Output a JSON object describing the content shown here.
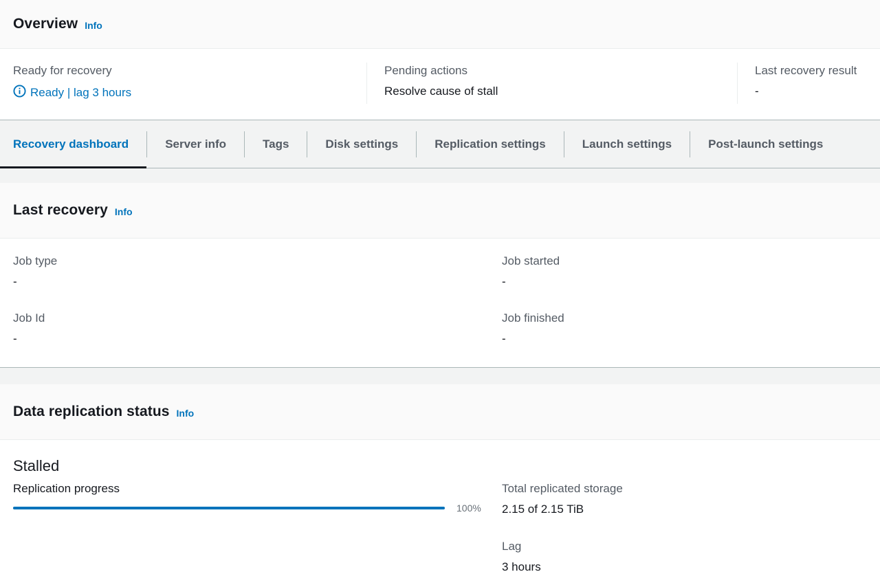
{
  "overview": {
    "title": "Overview",
    "info": "Info",
    "ready_label": "Ready for recovery",
    "ready_value": "Ready | lag 3 hours",
    "pending_label": "Pending actions",
    "pending_value": "Resolve cause of stall",
    "last_result_label": "Last recovery result",
    "last_result_value": "-"
  },
  "tabs": [
    {
      "label": "Recovery dashboard",
      "active": true
    },
    {
      "label": "Server info"
    },
    {
      "label": "Tags"
    },
    {
      "label": "Disk settings"
    },
    {
      "label": "Replication settings"
    },
    {
      "label": "Launch settings"
    },
    {
      "label": "Post-launch settings"
    }
  ],
  "last_recovery": {
    "title": "Last recovery",
    "info": "Info",
    "job_type_label": "Job type",
    "job_type_value": "-",
    "job_started_label": "Job started",
    "job_started_value": "-",
    "job_id_label": "Job Id",
    "job_id_value": "-",
    "job_finished_label": "Job finished",
    "job_finished_value": "-"
  },
  "data_replication": {
    "title": "Data replication status",
    "info": "Info",
    "status": "Stalled",
    "progress_label": "Replication progress",
    "progress_percent": 100,
    "progress_text": "100%",
    "storage_label": "Total replicated storage",
    "storage_value": "2.15 of 2.15 TiB",
    "lag_label": "Lag",
    "lag_value": "3 hours"
  },
  "colors": {
    "link": "#0073bb",
    "active_tab_underline": "#16191f",
    "progress": "#0073bb"
  },
  "icons": {
    "ready_status": "info-circle-icon"
  }
}
